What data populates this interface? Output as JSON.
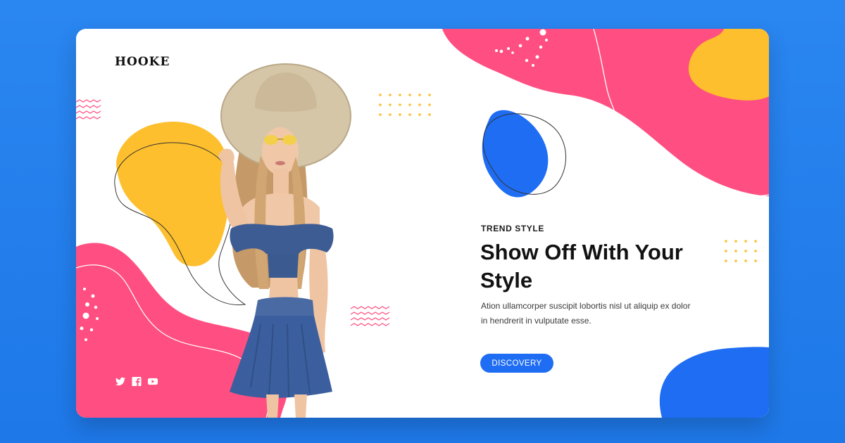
{
  "brand": {
    "logo_text": "HOOKE"
  },
  "hero": {
    "eyebrow": "TREND STYLE",
    "headline": "Show Off With Your Style",
    "body": "Ation ullamcorper suscipit lobortis nisl ut aliquip ex dolor in hendrerit in vulputate esse.",
    "cta_label": "DISCOVERY"
  },
  "social": [
    {
      "icon": "twitter-icon"
    },
    {
      "icon": "facebook-icon"
    },
    {
      "icon": "youtube-icon"
    }
  ],
  "colors": {
    "page_background": "#1e78e8",
    "card_background": "#ffffff",
    "pink": "#ff4f82",
    "yellow": "#fdbf2d",
    "blue": "#1f6df3",
    "text_dark": "#121212"
  }
}
